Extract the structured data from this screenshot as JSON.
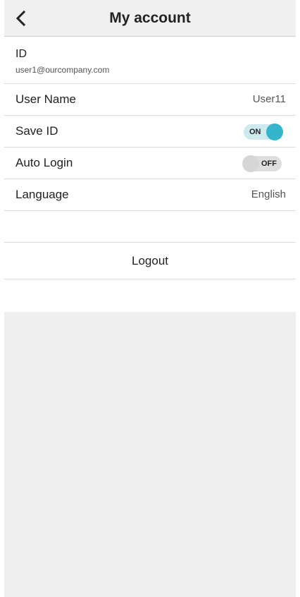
{
  "header": {
    "title": "My account",
    "back_icon": "chevron-left-icon"
  },
  "account": {
    "id_label": "ID",
    "id_value": "user1@ourcompany.com",
    "user_name_label": "User Name",
    "user_name_value": "User11",
    "save_id_label": "Save ID",
    "save_id_state": "ON",
    "auto_login_label": "Auto Login",
    "auto_login_state": "OFF",
    "language_label": "Language",
    "language_value": "English"
  },
  "actions": {
    "logout_label": "Logout"
  },
  "colors": {
    "header_bg": "#f0f0f0",
    "toggle_on_track": "#cfe9f0",
    "toggle_on_knob": "#33b5ce",
    "toggle_off_track": "#dedede",
    "background_panel": "#efefef"
  }
}
